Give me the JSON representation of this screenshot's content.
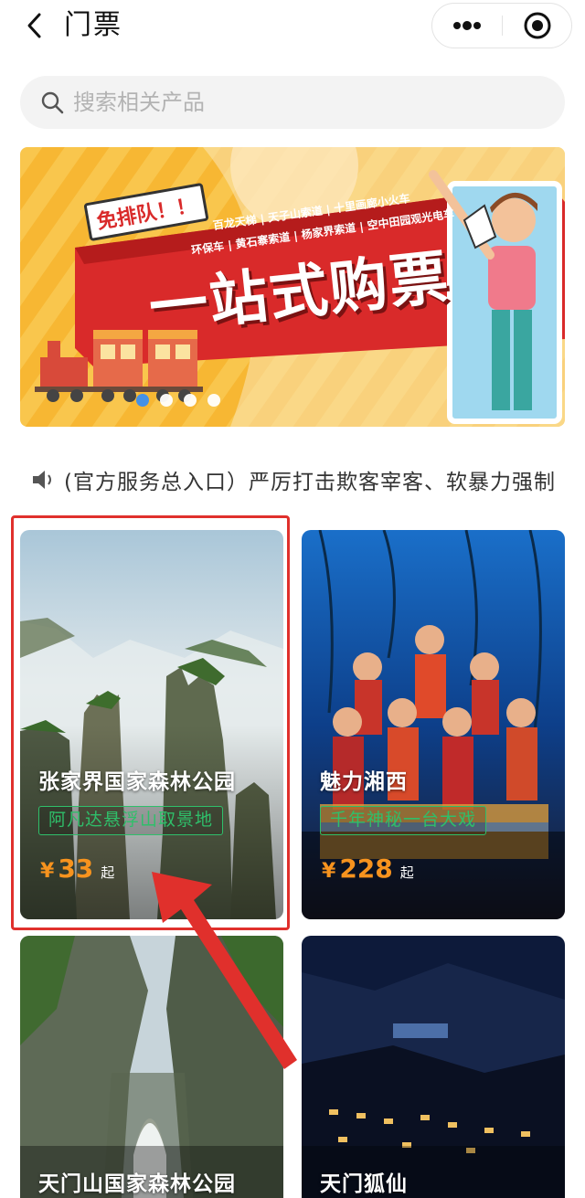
{
  "header": {
    "title": "门票"
  },
  "search": {
    "placeholder": "搜索相关产品"
  },
  "banner": {
    "badge": "免排队！！",
    "items_line1": "百龙天梯 | 天子山索道 | 十里画廊小火车",
    "items_line2": "环保车 | 黄石寨索道 | 杨家界索道 | 空中田园观光电车",
    "headline": "一站式购票",
    "slide_count": 4,
    "active_slide": 0
  },
  "notice": {
    "text": "(官方服务总入口）严厉打击欺客宰客、软暴力强制"
  },
  "cards": [
    {
      "title": "张家界国家森林公园",
      "tag": "阿凡达悬浮山取景地",
      "price_symbol": "¥",
      "price": "33",
      "price_suffix": "起"
    },
    {
      "title": "魅力湘西",
      "tag": "千年神秘一台大戏",
      "price_symbol": "¥",
      "price": "228",
      "price_suffix": "起"
    },
    {
      "title": "天门山国家森林公园"
    },
    {
      "title": "天门狐仙"
    }
  ],
  "colors": {
    "accent_price": "#f7931e",
    "tag_green": "#2fbf6a",
    "highlight_red": "#e0302c",
    "dot_active": "#3b8ef0"
  }
}
